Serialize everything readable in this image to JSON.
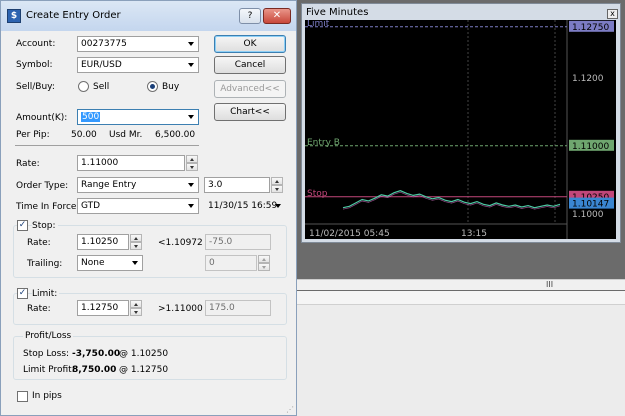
{
  "dialog": {
    "title": "Create Entry Order",
    "help": "?",
    "close": "✕",
    "account": {
      "label": "Account:",
      "value": "00273775"
    },
    "symbol": {
      "label": "Symbol:",
      "value": "EUR/USD"
    },
    "sellbuy": {
      "label": "Sell/Buy:",
      "sell": "Sell",
      "buy": "Buy"
    },
    "amount": {
      "label": "Amount(K):",
      "value": "500"
    },
    "perpip": {
      "label": "Per Pip:",
      "value": "50.00",
      "usdmr_label": "Usd Mr.",
      "usdmr_value": "6,500.00"
    },
    "rate": {
      "label": "Rate:",
      "value": "1.11000"
    },
    "order_type": {
      "label": "Order Type:",
      "value": "Range Entry",
      "range": "3.0"
    },
    "tif": {
      "label": "Time In Force:",
      "value": "GTD",
      "date": "11/30/15 16:59"
    },
    "stop": {
      "label": "Stop:",
      "checked": true,
      "rate_label": "Rate:",
      "rate": "1.10250",
      "compare": "<1.10972",
      "pips": "-75.0",
      "trailing_label": "Trailing:",
      "trailing": "None",
      "trailing_value": "0"
    },
    "limit": {
      "label": "Limit:",
      "checked": true,
      "rate_label": "Rate:",
      "rate": "1.12750",
      "compare": ">1.11000",
      "pips": "175.0"
    },
    "pl": {
      "title": "Profit/Loss",
      "stop_label": "Stop Loss:",
      "stop_value": "-3,750.00",
      "stop_at": "@ 1.10250",
      "limit_label": "Limit Profit:",
      "limit_value": "8,750.00",
      "limit_at": "@ 1.12750"
    },
    "inpips": {
      "label": "In pips",
      "checked": false
    },
    "buttons": {
      "ok": "OK",
      "cancel": "Cancel",
      "advanced": "Advanced<<",
      "chart": "Chart<<"
    }
  },
  "chart_window": {
    "title": "Five Minutes",
    "close": "x",
    "labels": {
      "limit": "Limit",
      "entry": "Entry B",
      "stop": "Stop"
    },
    "price_ticks": [
      "1.12750",
      "1.1200",
      "1.11000",
      "1.10250",
      "1.10147",
      "1.1000"
    ],
    "time_ticks": [
      "11/02/2015 05:45",
      "13:15"
    ],
    "colors": {
      "limit": "#7c7cc4",
      "entry": "#6fa66f",
      "stop": "#c2477a",
      "current": "#3a86d1"
    }
  },
  "bottom": {
    "grip": "III"
  },
  "chart_data": {
    "type": "line",
    "title": "Five Minutes",
    "ylim": [
      1.0985,
      1.1285
    ],
    "x": [
      "11/02/2015 05:45",
      "13:15"
    ],
    "horizontal_lines": [
      {
        "name": "Limit",
        "value": 1.1275
      },
      {
        "name": "Entry B",
        "value": 1.11
      },
      {
        "name": "Stop",
        "value": 1.1025
      }
    ],
    "series": [
      {
        "values": [
          1.1009,
          1.1011,
          1.1016,
          1.1021,
          1.1019,
          1.1023,
          1.1028,
          1.1026,
          1.1031,
          1.1034,
          1.103,
          1.1027,
          1.1029,
          1.1025,
          1.1022,
          1.1024,
          1.102,
          1.1018,
          1.1021,
          1.1017,
          1.1015,
          1.1018,
          1.1014,
          1.1012,
          1.1016,
          1.1013,
          1.1011,
          1.1013,
          1.101,
          1.1012,
          1.1009,
          1.1011,
          1.1013,
          1.1011,
          1.1014
        ]
      }
    ]
  }
}
